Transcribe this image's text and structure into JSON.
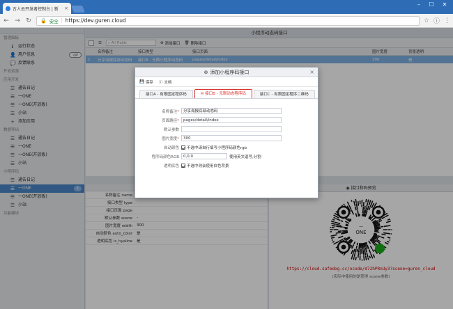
{
  "browser": {
    "tab_title": "古人云开发者控制台 | 新",
    "secure_label": "安全",
    "url": "https://dev.guren.cloud"
  },
  "sidebar": {
    "groups": [
      {
        "label": "管理面板",
        "items": [
          {
            "label": "运行状态",
            "icon": "info-icon"
          },
          {
            "label": "用户信息",
            "icon": "user-icon",
            "badge": "VIP"
          },
          {
            "label": "反馈联系",
            "icon": "chat-icon"
          }
        ]
      },
      {
        "label": "开发资源",
        "items": []
      },
      {
        "label": "应用开发",
        "items": [
          {
            "label": "通告日记",
            "icon": "list-icon"
          },
          {
            "label": "一ONE",
            "icon": "list-icon"
          },
          {
            "label": "一ONE(开放板)",
            "icon": "list-icon"
          },
          {
            "label": "小站",
            "icon": "list-icon"
          },
          {
            "label": "添加应用",
            "icon": "plus-icon"
          }
        ]
      },
      {
        "label": "数据导出",
        "items": [
          {
            "label": "通告日记",
            "icon": "list-icon"
          },
          {
            "label": "一ONE",
            "icon": "list-icon"
          },
          {
            "label": "一ONE(开放板)",
            "icon": "list-icon"
          },
          {
            "label": "小站",
            "icon": "list-icon"
          }
        ]
      },
      {
        "label": "小程序码",
        "items": [
          {
            "label": "通告日记",
            "icon": "list-icon"
          },
          {
            "label": "一ONE",
            "icon": "list-icon",
            "badge": "1",
            "active": true
          },
          {
            "label": "一ONE(开放板)",
            "icon": "list-icon"
          },
          {
            "label": "小站",
            "icon": "list-icon"
          }
        ]
      },
      {
        "label": "功能模块",
        "items": []
      }
    ]
  },
  "main": {
    "panel_title": "小程序动态码接口",
    "toolbar": {
      "search_placeholder": "All Fields",
      "add_label": "添加接口",
      "delete_label": "删除接口"
    },
    "columns": [
      "名称备注",
      "接口类型",
      "接口页面",
      "图片宽度",
      "背景透明"
    ],
    "rows": [
      [
        "分享海报底部动态码",
        "接口B - 无限小程序动态码",
        "pages/detail/index",
        "300",
        "是"
      ]
    ]
  },
  "properties": {
    "rows": [
      {
        "key": "名称备注 name",
        "value": ""
      },
      {
        "key": "接口类型 type",
        "value": ""
      },
      {
        "key": "接口页面 page",
        "value": ""
      },
      {
        "key": "默认参数 scene",
        "value": "-"
      },
      {
        "key": "图片宽度 width",
        "value": "300"
      },
      {
        "key": "自动颜色 auto_color",
        "value": "是"
      },
      {
        "key": "透明底色 is_hyaline",
        "value": "是"
      }
    ]
  },
  "preview": {
    "title": "接口和码预览",
    "qr_center_label": "ONE",
    "link": "https://cloud.safedog.cc/ocode/d72hPRnUy3?scene=guren_cloud",
    "note": "(实际中使用的是获得 scene参数)"
  },
  "modal": {
    "title": "添加小程序码接口",
    "save_label": "保存",
    "doc_label": "文档",
    "tabs": [
      "接口A - 有限固定程序码",
      "接口B - 无限动态程序码",
      "接口C - 有限固定程序二维码"
    ],
    "fields": {
      "name_label": "名称备注",
      "name_value": "分享海报底部动态码",
      "page_label": "页面路径",
      "page_value": "pages/detail/index",
      "scene_label": "默认参数",
      "scene_value": "",
      "width_label": "图片宽度",
      "width_value": "300",
      "auto_color_label": "自动颜色",
      "auto_color_text": "不选中请自行填写小程序码颜色rgb",
      "rgb_label": "程序码颜色RGB",
      "rgb_value": "0,0,0",
      "rgb_hint": "使用英文逗号,分割",
      "hyaline_label": "透明底色",
      "hyaline_text": "不选中则会使用白色背景"
    }
  },
  "colors": {
    "accent": "#4a87c8",
    "selected_row": "#7fb1e4",
    "active_tab": "#d9312c",
    "tabbar": "#2e6db6"
  }
}
